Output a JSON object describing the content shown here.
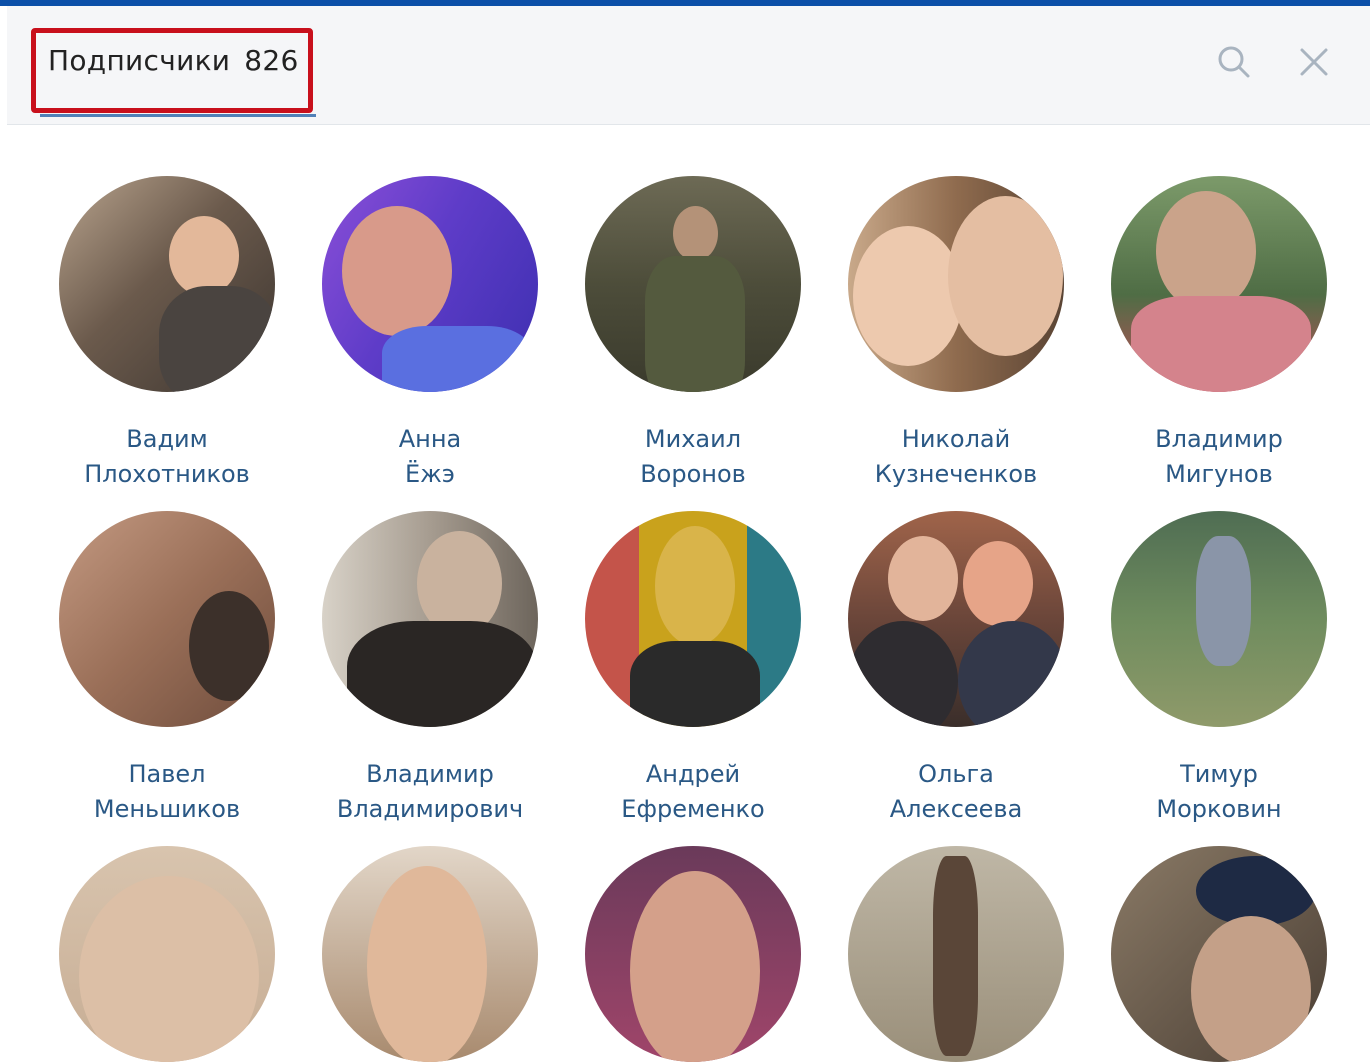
{
  "header": {
    "tab_label": "Подписчики",
    "tab_count": "826",
    "search_icon": "search-icon",
    "close_icon": "close-icon"
  },
  "followers": [
    {
      "first": "Вадим",
      "last": "Плохотников"
    },
    {
      "first": "Анна",
      "last": "Ёжэ"
    },
    {
      "first": "Михаил",
      "last": "Воронов"
    },
    {
      "first": "Николай",
      "last": "Кузнеченков"
    },
    {
      "first": "Владимир",
      "last": "Мигунов"
    },
    {
      "first": "Павел",
      "last": "Меньшиков"
    },
    {
      "first": "Владимир",
      "last": "Владимирович"
    },
    {
      "first": "Андрей",
      "last": "Ефременко"
    },
    {
      "first": "Ольга",
      "last": "Алексеева"
    },
    {
      "first": "Тимур",
      "last": "Морковин"
    }
  ],
  "colors": {
    "accent": "#5181b8",
    "link": "#2a5885",
    "highlight": "#c8101c",
    "topbar": "#0b4fa8"
  }
}
